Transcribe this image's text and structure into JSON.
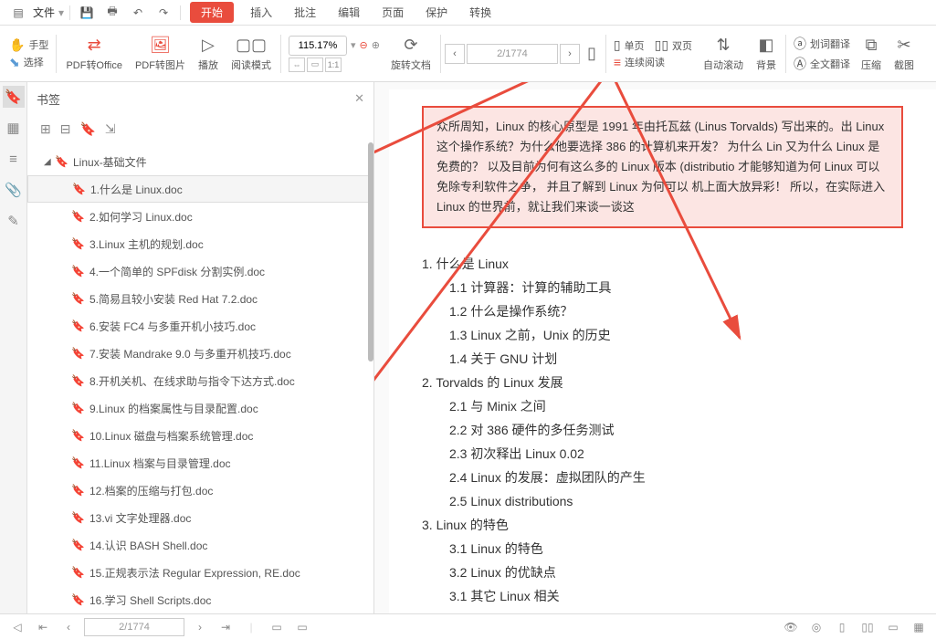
{
  "titlebar": {
    "file_label": "文件",
    "tabs": {
      "start": "开始",
      "insert": "插入",
      "annotate": "批注",
      "edit": "编辑",
      "page": "页面",
      "protect": "保护",
      "convert": "转换"
    }
  },
  "toolbar": {
    "hand": "手型",
    "select": "选择",
    "pdf_office": "PDF转Office",
    "pdf_image": "PDF转图片",
    "play": "播放",
    "read_mode": "阅读模式",
    "zoom": "115.17%",
    "rotate": "旋转文档",
    "page_nav": "2/1774",
    "single_page": "单页",
    "double_page": "双页",
    "continuous": "连续阅读",
    "auto_scroll": "自动滚动",
    "background": "背景",
    "dict_translate": "划词翻译",
    "full_translate": "全文翻译",
    "compress": "压缩",
    "screenshot": "截图"
  },
  "sidebar": {
    "title": "书签",
    "root": "Linux-基础文件",
    "items": [
      "1.什么是 Linux.doc",
      "2.如何学习 Linux.doc",
      "3.Linux 主机的规划.doc",
      "4.一个简单的 SPFdisk 分割实例.doc",
      "5.简易且较小安装 Red Hat 7.2.doc",
      "6.安装 FC4 与多重开机小技巧.doc",
      "7.安装 Mandrake 9.0 与多重开机技巧.doc",
      "8.开机关机、在线求助与指令下达方式.doc",
      "9.Linux 的档案属性与目录配置.doc",
      "10.Linux 磁盘与档案系统管理.doc",
      "11.Linux 档案与目录管理.doc",
      "12.档案的压缩与打包.doc",
      "13.vi 文字处理器.doc",
      "14.认识 BASH Shell.doc",
      "15.正规表示法 Regular Expression, RE.doc",
      "16.学习 Shell Scripts.doc"
    ]
  },
  "document": {
    "intro": "众所周知，Linux 的核心原型是 1991 年由托瓦兹 (Linus Torvalds) 写出来的。出 Linux 这个操作系统？为什么他要选择 386 的计算机来开发？ 为什么 Lin 又为什么 Linux 是免费的？ 以及目前为何有这么多的 Linux 版本 (distributio 才能够知道为何 Linux 可以免除专利软件之争， 并且了解到 Linux 为何可以 机上面大放异彩！ 所以，在实际进入 Linux 的世界前，就让我们来谈一谈这",
    "toc": [
      {
        "lvl": 1,
        "t": "1. 什么是 Linux"
      },
      {
        "lvl": 2,
        "t": "1.1 计算器：计算的辅助工具"
      },
      {
        "lvl": 2,
        "t": "1.2 什么是操作系统？"
      },
      {
        "lvl": 2,
        "t": "1.3 Linux 之前，Unix 的历史"
      },
      {
        "lvl": 2,
        "t": "1.4 关于 GNU 计划"
      },
      {
        "lvl": 1,
        "t": "2. Torvalds 的 Linux 发展"
      },
      {
        "lvl": 2,
        "t": "2.1 与 Minix 之间"
      },
      {
        "lvl": 2,
        "t": "2.2 对 386 硬件的多任务测试"
      },
      {
        "lvl": 2,
        "t": "2.3 初次释出 Linux 0.02"
      },
      {
        "lvl": 2,
        "t": "2.4 Linux 的发展：虚拟团队的产生"
      },
      {
        "lvl": 2,
        "t": "2.5 Linux distributions"
      },
      {
        "lvl": 1,
        "t": "3. Linux 的特色"
      },
      {
        "lvl": 2,
        "t": "3.1 Linux 的特色"
      },
      {
        "lvl": 2,
        "t": "3.2 Linux 的优缺点"
      },
      {
        "lvl": 2,
        "t": "3.1 其它 Linux 相关"
      }
    ]
  },
  "statusbar": {
    "page": "2/1774"
  }
}
